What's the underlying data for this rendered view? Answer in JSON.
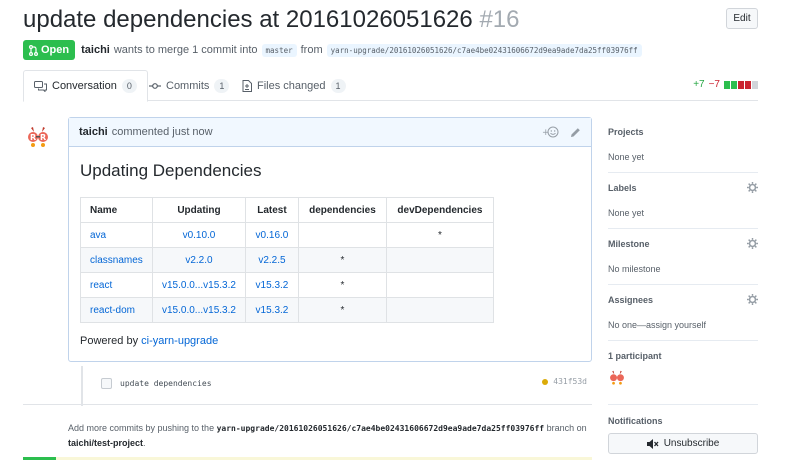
{
  "pr": {
    "title": "update dependencies at 20161026051626",
    "number": "#16",
    "edit_label": "Edit",
    "state": "Open",
    "author": "taichi",
    "merge_text": "wants to merge 1 commit into",
    "base_branch": "master",
    "from_text": "from",
    "head_branch": "yarn-upgrade/20161026051626/c7ae4be02431606672d9ea9ade7da25ff03976ff"
  },
  "tabs": [
    {
      "label": "Conversation",
      "count": "0"
    },
    {
      "label": "Commits",
      "count": "1"
    },
    {
      "label": "Files changed",
      "count": "1"
    }
  ],
  "diffstat": {
    "additions": "+7",
    "deletions": "−7"
  },
  "comment": {
    "author": "taichi",
    "action": "commented just now",
    "heading": "Updating Dependencies",
    "table": {
      "headers": [
        "Name",
        "Updating",
        "Latest",
        "dependencies",
        "devDependencies"
      ],
      "rows": [
        [
          "ava",
          "v0.10.0",
          "v0.16.0",
          "",
          "*"
        ],
        [
          "classnames",
          "v2.2.0",
          "v2.2.5",
          "*",
          ""
        ],
        [
          "react",
          "v15.0.0...v15.3.2",
          "v15.3.2",
          "*",
          ""
        ],
        [
          "react-dom",
          "v15.0.0...v15.3.2",
          "v15.3.2",
          "*",
          ""
        ]
      ]
    },
    "powered_prefix": "Powered by",
    "powered_link": "ci-yarn-upgrade"
  },
  "commit": {
    "message": "update dependencies",
    "sha": "431f53d"
  },
  "push_note": {
    "prefix": "Add more commits by pushing to the",
    "branch": "yarn-upgrade/20161026051626/c7ae4be02431606672d9ea9ade7da25ff03976ff",
    "middle": "branch",
    "on": "on",
    "repo": "taichi/test-project",
    "suffix": "."
  },
  "sidebar": {
    "projects": {
      "title": "Projects",
      "value": "None yet"
    },
    "labels": {
      "title": "Labels",
      "value": "None yet"
    },
    "milestone": {
      "title": "Milestone",
      "value": "No milestone"
    },
    "assignees": {
      "title": "Assignees",
      "value": "No one—assign yourself"
    },
    "participants": {
      "title": "1 participant"
    },
    "notifications": {
      "title": "Notifications",
      "button": "Unsubscribe"
    }
  },
  "colors": {
    "open": "#2cbe4e",
    "link": "#0366d6",
    "additions": "#28a745",
    "deletions": "#cb2431"
  }
}
